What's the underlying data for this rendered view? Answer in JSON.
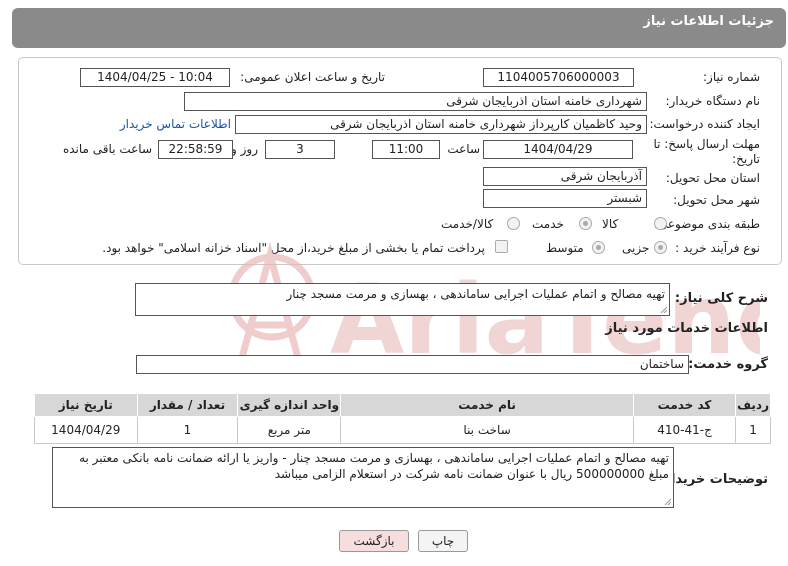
{
  "header": {
    "title": "جزئیات اطلاعات نیاز"
  },
  "form": {
    "need_number_label": "شماره نیاز:",
    "need_number": "1104005706000003",
    "announce_label": "تاریخ و ساعت اعلان عمومی:",
    "announce_value": "1404/04/25 - 10:04",
    "buyer_org_label": "نام دستگاه خریدار:",
    "buyer_org": "شهرداری خامنه استان اذربایجان شرقی",
    "creator_label": "ایجاد کننده درخواست:",
    "creator": "وحید کاظمیان کارپرداز شهرداری خامنه استان اذربایجان شرقی",
    "contact_link": "اطلاعات تماس خریدار",
    "deadline_label_1": "مهلت ارسال پاسخ: تا",
    "deadline_label_2": "تاریخ:",
    "deadline_date": "1404/04/29",
    "time_label": "ساعت",
    "deadline_time": "11:00",
    "days_value": "3",
    "days_label": "روز و",
    "remaining_time": "22:58:59",
    "remaining_label": "ساعت باقی مانده",
    "province_label": "استان محل تحویل:",
    "province": "آذربایجان شرقی",
    "city_label": "شهر محل تحویل:",
    "city": "شبستر",
    "category_label": "طبقه بندی موضوعی:",
    "category_options": [
      "کالا",
      "خدمت",
      "کالا/خدمت"
    ],
    "category_selected": "خدمت",
    "process_label": "نوع فرآیند خرید :",
    "process_options": [
      "جزیی",
      "متوسط"
    ],
    "process_selected": "جزیی",
    "payment_note": "پرداخت تمام یا بخشی از مبلغ خرید،از محل \"اسناد خزانه اسلامی\" خواهد بود."
  },
  "summary": {
    "label": "شرح کلی نیاز:",
    "text": "تهیه مصالح و اتمام عملیات اجرایی ساماندهی ، بهسازی و مرمت مسجد چنار"
  },
  "services": {
    "title": "اطلاعات خدمات مورد نیاز",
    "group_label": "گروه خدمت:",
    "group_value": "ساختمان",
    "columns": [
      "ردیف",
      "کد خدمت",
      "نام خدمت",
      "واحد اندازه گیری",
      "تعداد / مقدار",
      "تاریخ نیاز"
    ],
    "rows": [
      {
        "row": "1",
        "code": "ج-41-410",
        "name": "ساخت بنا",
        "unit": "متر مربع",
        "qty": "1",
        "date": "1404/04/29"
      }
    ]
  },
  "buyer_notes": {
    "label": "توضیحات خریدار:",
    "text": "تهیه مصالح و اتمام عملیات اجرایی ساماندهی ، بهسازی و مرمت مسجد چنار - واریز یا ارائه ضمانت نامه بانکی معتبر به مبلغ 500000000 ریال با عنوان ضمانت نامه  شرکت در استعلام الزامی میباشد"
  },
  "actions": {
    "print": "چاپ",
    "back": "بازگشت"
  },
  "watermark": {
    "text": "AriaTender.neT"
  },
  "colors": {
    "header_bg": "#8a8a8a",
    "link": "#1a55a5",
    "back_button_bg": "#f6dede",
    "watermark": "#e7b3b3"
  }
}
